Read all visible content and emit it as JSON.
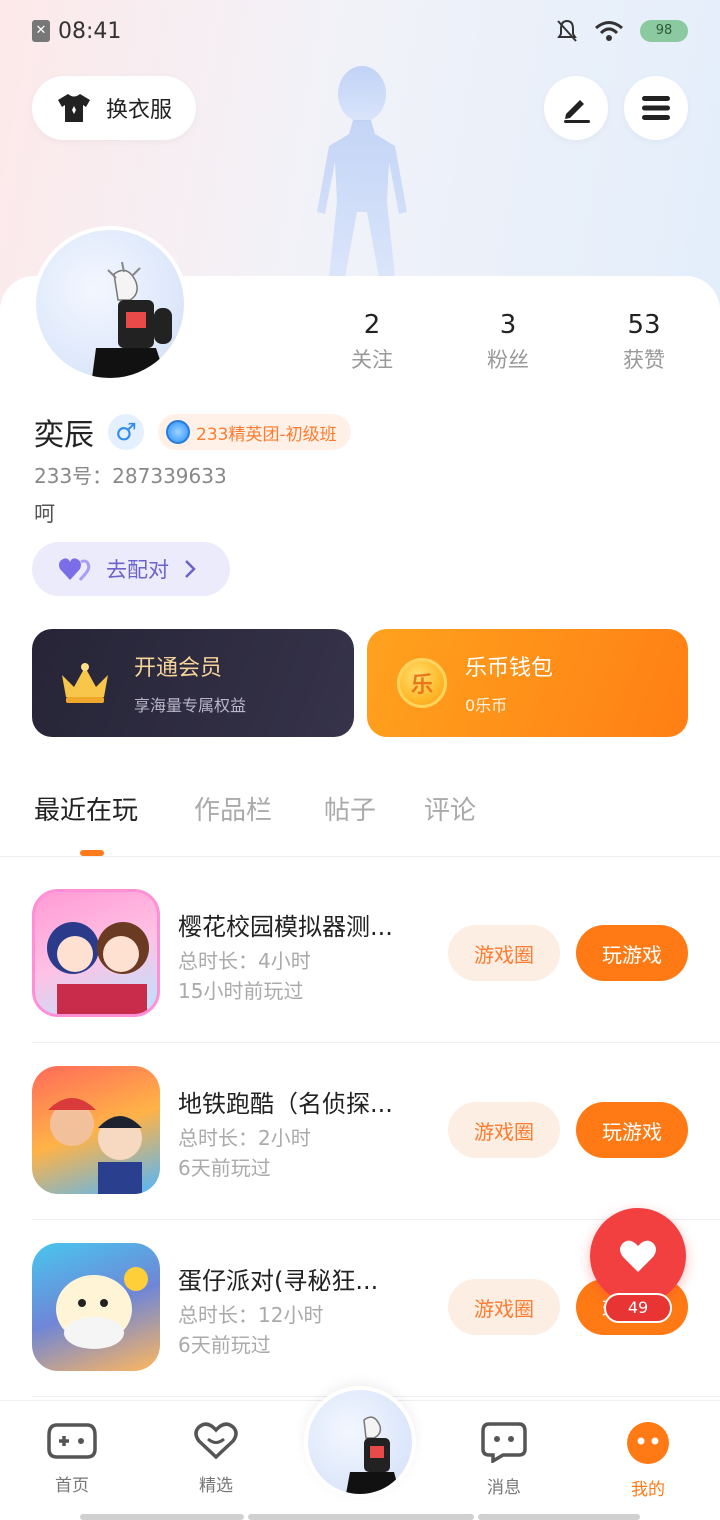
{
  "status_bar": {
    "time": "08:41",
    "battery": "98"
  },
  "top": {
    "dress_label": "换衣服"
  },
  "profile": {
    "stats": [
      {
        "num": "2",
        "label": "关注"
      },
      {
        "num": "3",
        "label": "粉丝"
      },
      {
        "num": "53",
        "label": "获赞"
      }
    ],
    "name": "奕辰",
    "gender_symbol": "♂",
    "badge": "233精英团-初级班",
    "uid": "233号：287339633",
    "bio": "呵",
    "match_label": "去配对"
  },
  "vip": {
    "title": "开通会员",
    "sub": "享海量专属权益"
  },
  "wallet": {
    "title": "乐币钱包",
    "sub": "0乐币",
    "coin": "乐"
  },
  "tabs": [
    "最近在玩",
    "作品栏",
    "帖子",
    "评论"
  ],
  "games": [
    {
      "title": "樱花校园模拟器测...",
      "duration": "总时长：4小时",
      "last": "15小时前玩过",
      "circle": "游戏圈",
      "play": "玩游戏"
    },
    {
      "title": "地铁跑酷（名侦探...",
      "duration": "总时长：2小时",
      "last": "6天前玩过",
      "circle": "游戏圈",
      "play": "玩游戏"
    },
    {
      "title": "蛋仔派对(寻秘狂...",
      "duration": "总时长：12小时",
      "last": "6天前玩过",
      "circle": "游戏圈",
      "play": "玩游戏"
    }
  ],
  "heart_count": "49",
  "nav": [
    {
      "label": "首页"
    },
    {
      "label": "精选"
    },
    {
      "label": "消息"
    },
    {
      "label": "我的"
    }
  ],
  "colors": {
    "accent": "#ff7a14",
    "heart": "#f24040"
  }
}
